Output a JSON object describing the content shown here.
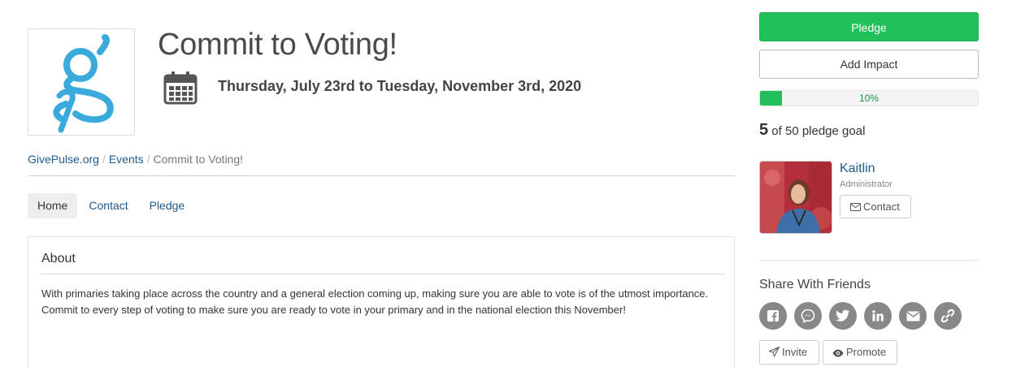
{
  "event": {
    "title": "Commit to Voting!",
    "dates": "Thursday, July 23rd to Tuesday, November 3rd, 2020"
  },
  "breadcrumb": {
    "items": [
      "GivePulse.org",
      "Events",
      "Commit to Voting!"
    ]
  },
  "tabs": [
    {
      "label": "Home",
      "active": true
    },
    {
      "label": "Contact",
      "active": false
    },
    {
      "label": "Pledge",
      "active": false
    }
  ],
  "about": {
    "title": "About",
    "body": "With primaries taking place across the country and a general election coming up, making sure you are able to vote is of the utmost importance. Commit to every step of voting to make sure you are ready to vote in your primary and in the national election this November!"
  },
  "sidebar": {
    "pledge_label": "Pledge",
    "impact_label": "Add Impact",
    "progress_percent": 10,
    "progress_label": "10%",
    "goal_count": "5",
    "goal_text": "of 50 pledge goal",
    "admin": {
      "name": "Kaitlin",
      "role": "Administrator",
      "contact_label": "Contact"
    },
    "share": {
      "title": "Share With Friends",
      "icons": [
        "facebook-icon",
        "messenger-icon",
        "twitter-icon",
        "linkedin-icon",
        "email-icon",
        "link-icon"
      ]
    },
    "invite_label": "Invite",
    "promote_label": "Promote"
  },
  "colors": {
    "accent_green": "#22c05a",
    "link_blue": "#1f5a8c",
    "logo_blue": "#3aa9dc"
  }
}
